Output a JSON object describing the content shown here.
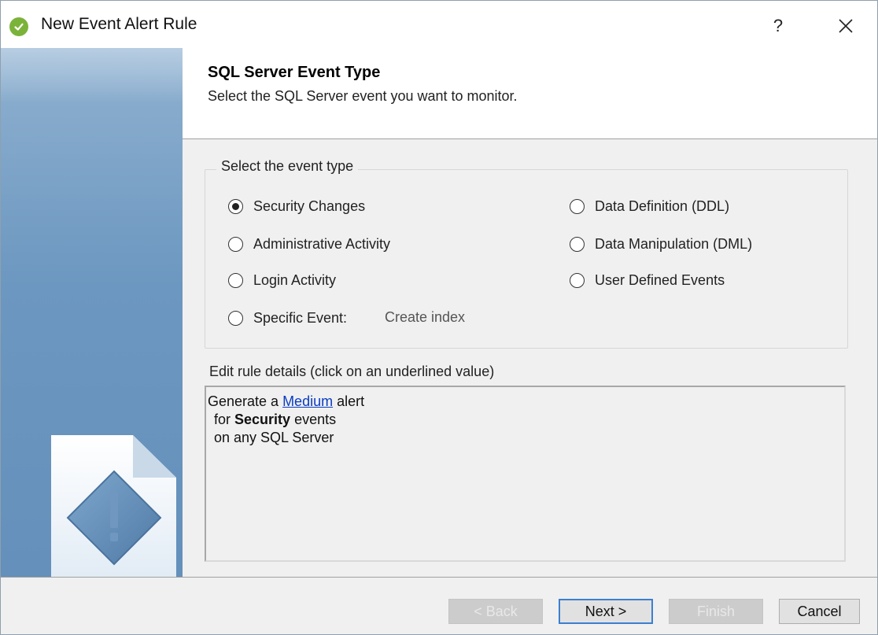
{
  "window": {
    "title": "New Event Alert Rule",
    "help_label": "?",
    "close_icon": "close-icon",
    "app_icon": "checkmark-badge-icon",
    "accent_color": "#7bb33a"
  },
  "header": {
    "title": "SQL Server Event Type",
    "subtitle": "Select the SQL Server event you want to monitor."
  },
  "event_type": {
    "legend": "Select the event type",
    "selected": "Security Changes",
    "options": [
      {
        "label": "Security Changes",
        "checked": true
      },
      {
        "label": "Administrative Activity",
        "checked": false
      },
      {
        "label": "Login Activity",
        "checked": false
      },
      {
        "label": "Specific Event:",
        "checked": false
      },
      {
        "label": "Data Definition (DDL)",
        "checked": false
      },
      {
        "label": "Data Manipulation (DML)",
        "checked": false
      },
      {
        "label": "User Defined Events",
        "checked": false
      }
    ],
    "specific_event_value": "Create index"
  },
  "rule_details": {
    "label": "Edit rule details (click on an underlined value)",
    "line1_prefix": "Generate a ",
    "line1_link": "Medium",
    "line1_suffix": " alert",
    "line2_prefix": "for ",
    "line2_bold": "Security",
    "line2_suffix": " events",
    "line3": "on any SQL Server"
  },
  "buttons": {
    "back": "< Back",
    "next": "Next >",
    "finish": "Finish",
    "cancel": "Cancel"
  },
  "banner": {
    "graphic_icon": "alert-diamond-icon"
  }
}
